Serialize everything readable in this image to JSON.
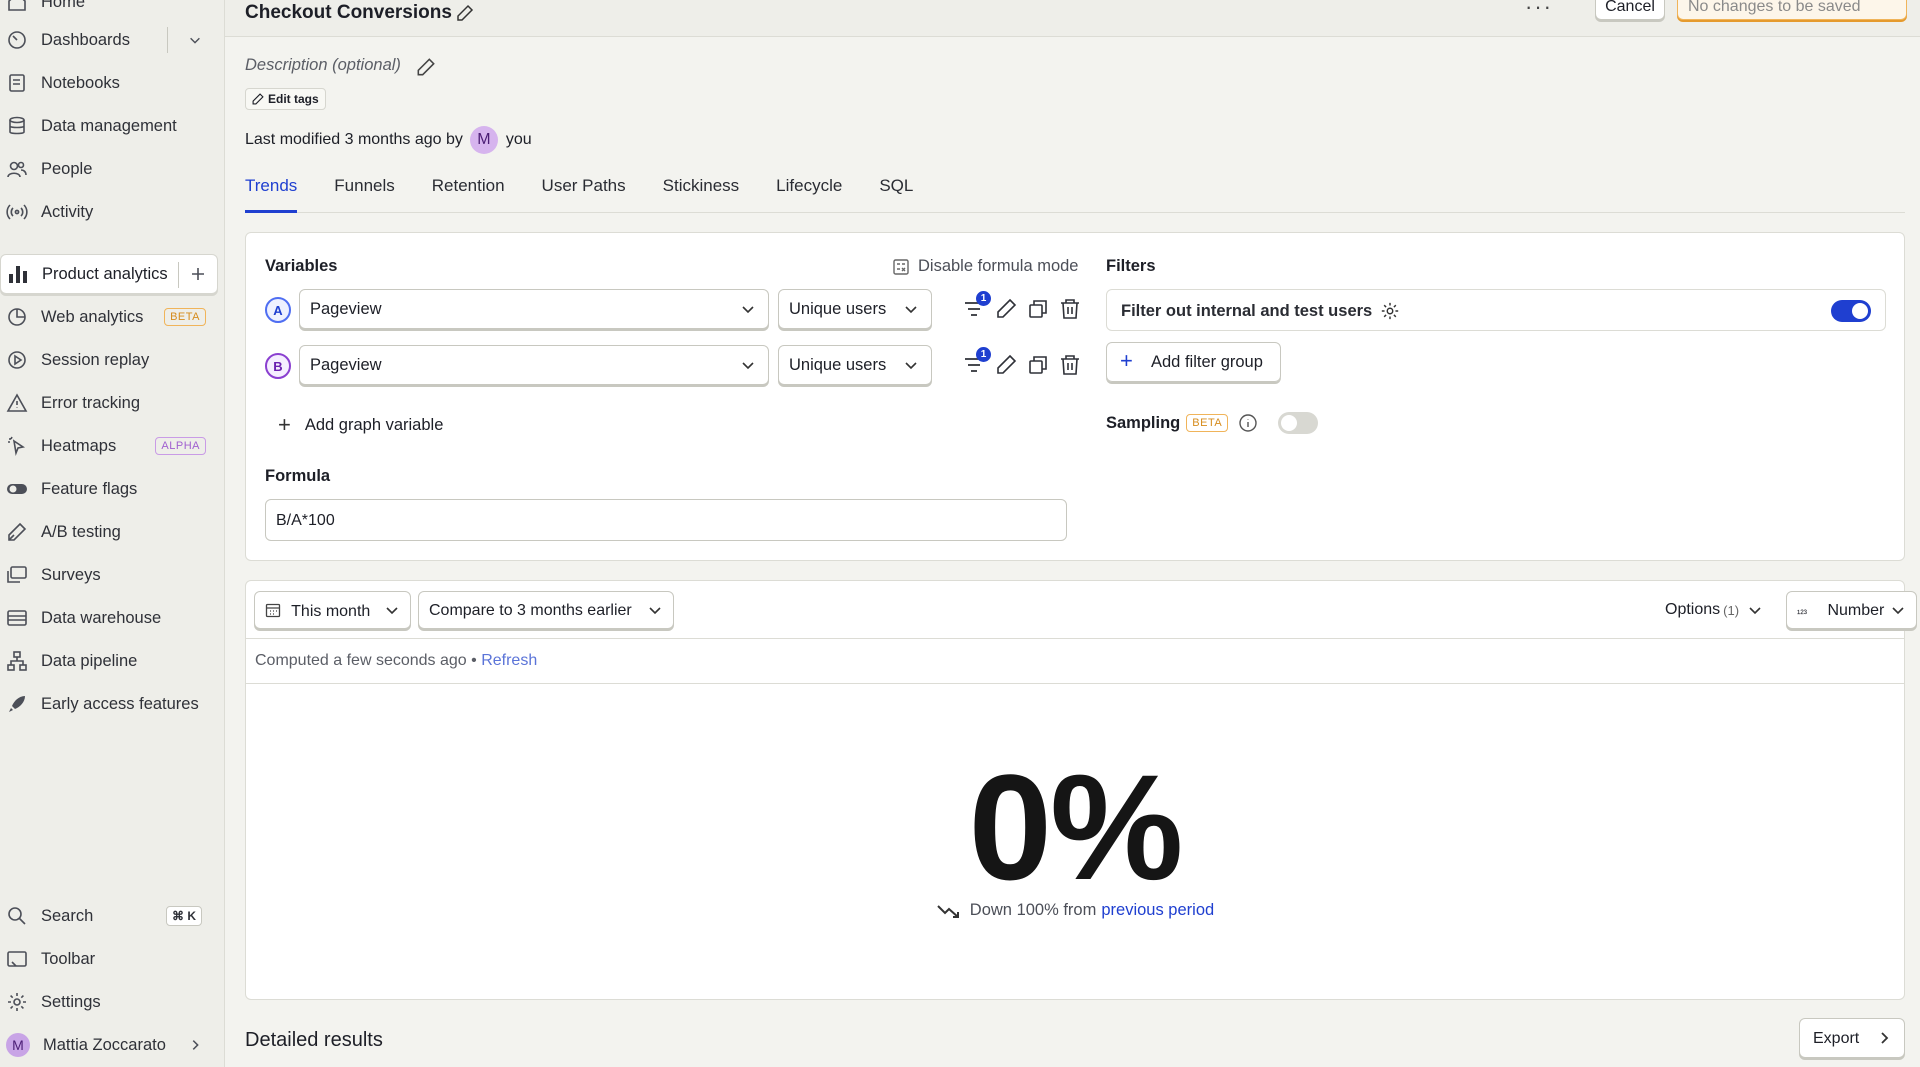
{
  "sidebar": {
    "home": "Home",
    "items": [
      {
        "label": "Dashboards",
        "icon": "gauge-icon"
      },
      {
        "label": "Notebooks",
        "icon": "notebook-icon"
      },
      {
        "label": "Data management",
        "icon": "database-icon"
      },
      {
        "label": "People",
        "icon": "people-icon"
      },
      {
        "label": "Activity",
        "icon": "activity-icon"
      }
    ],
    "products": [
      {
        "label": "Product analytics",
        "icon": "bar-chart-icon",
        "active": true
      },
      {
        "label": "Web analytics",
        "icon": "pie-chart-icon",
        "badge": "BETA"
      },
      {
        "label": "Session replay",
        "icon": "replay-icon"
      },
      {
        "label": "Error tracking",
        "icon": "warning-icon"
      },
      {
        "label": "Heatmaps",
        "icon": "cursor-icon",
        "badge": "ALPHA"
      },
      {
        "label": "Feature flags",
        "icon": "toggle-icon"
      },
      {
        "label": "A/B testing",
        "icon": "flask-icon"
      },
      {
        "label": "Surveys",
        "icon": "chat-icon"
      },
      {
        "label": "Data warehouse",
        "icon": "warehouse-icon"
      },
      {
        "label": "Data pipeline",
        "icon": "pipeline-icon"
      },
      {
        "label": "Early access features",
        "icon": "rocket-icon"
      }
    ],
    "bottom": {
      "search": "Search",
      "search_shortcut": "⌘ K",
      "toolbar": "Toolbar",
      "settings": "Settings",
      "user_name": "Mattia Zoccarato",
      "user_initial": "M"
    }
  },
  "header": {
    "title": "Cheсkout Conversions",
    "more": "···",
    "cancel_label": "Cancel",
    "save_label": "No changes to be saved"
  },
  "insight": {
    "description_placeholder": "Description (optional)",
    "edit_tags_label": "Edit tags",
    "last_modified_prefix": "Last modified 3 months ago by",
    "modified_by_initial": "M",
    "modified_by": "you"
  },
  "tabs": [
    "Trends",
    "Funnels",
    "Retention",
    "User Paths",
    "Stickiness",
    "Lifecycle",
    "SQL"
  ],
  "active_tab": "Trends",
  "query": {
    "variables_label": "Variables",
    "disable_formula_label": "Disable formula mode",
    "series": [
      {
        "letter": "A",
        "event": "Pageview",
        "math": "Unique users",
        "filter_count": "1"
      },
      {
        "letter": "B",
        "event": "Pageview",
        "math": "Unique users",
        "filter_count": "1"
      }
    ],
    "add_variable_label": "Add graph variable",
    "formula_label": "Formula",
    "formula_value": "B/A*100",
    "filters_label": "Filters",
    "internal_filter_label": "Filter out internal and test users",
    "internal_filter_enabled": true,
    "add_filter_group_label": "Add filter group",
    "sampling_label": "Sampling",
    "sampling_badge": "BETA",
    "sampling_enabled": false
  },
  "results": {
    "date_range": "This month",
    "compare": "Compare to 3 months earlier",
    "options_label": "Options",
    "options_count": "(1)",
    "display_type": "Number",
    "computed_text": "Computed a few seconds ago",
    "separator": "•",
    "refresh_label": "Refresh",
    "value": "0%",
    "trend_text": "Down 100% from",
    "trend_link": "previous period",
    "detailed_label": "Detailed results",
    "export_label": "Export"
  },
  "colors": {
    "accent": "#1f3fd0",
    "warning": "#f0b45a",
    "series_a": "#4f6ef2",
    "series_b": "#8a3fd0"
  }
}
